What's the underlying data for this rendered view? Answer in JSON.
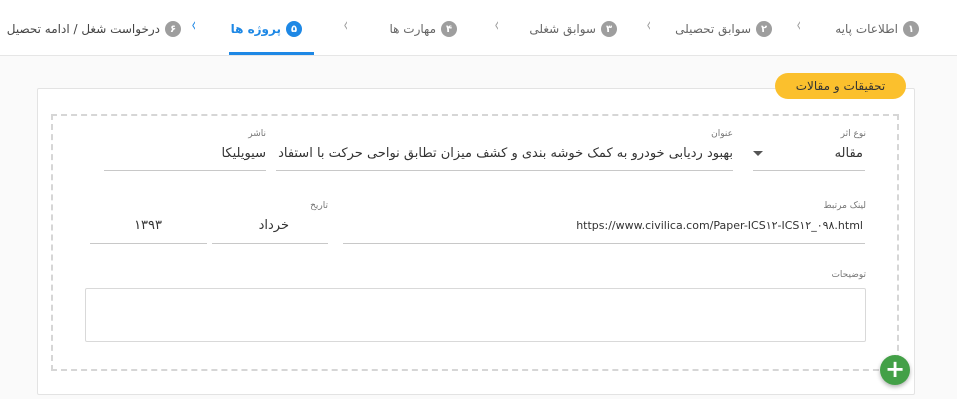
{
  "stepper": {
    "steps": [
      {
        "num": "۱",
        "label": "اطلاعات پایه"
      },
      {
        "num": "۲",
        "label": "سوابق تحصیلی"
      },
      {
        "num": "۳",
        "label": "سوابق شغلی"
      },
      {
        "num": "۴",
        "label": "مهارت ها"
      },
      {
        "num": "۵",
        "label": "پروژه ها"
      },
      {
        "num": "۶",
        "label": "درخواست شغل / ادامه تحصیل"
      }
    ],
    "active_index": 4
  },
  "section": {
    "title": "تحقیقات و مقالات"
  },
  "form": {
    "type_label": "نوع اثر",
    "type_value": "مقاله",
    "title_label": "عنوان",
    "title_value": "بهبود ردیابی خودرو به کمک خوشه بندی و کشف میزان تطابق نواحی حرکت با استفاد",
    "publisher_label": "ناشر",
    "publisher_value": "سیویلیکا",
    "link_label": "لینک مرتبط",
    "link_value": "https://www.civilica.com/Paper-ICS۱۲-ICS۱۲_۰۹۸.html",
    "date_label": "تاریخ",
    "month_value": "خرداد",
    "year_value": "۱۳۹۳",
    "description_label": "توضیحات",
    "description_value": ""
  },
  "actions": {
    "add_symbol": "+"
  },
  "colors": {
    "accent": "#1e88e5",
    "section_tag": "#fbc02d",
    "add_button": "#43a047"
  }
}
